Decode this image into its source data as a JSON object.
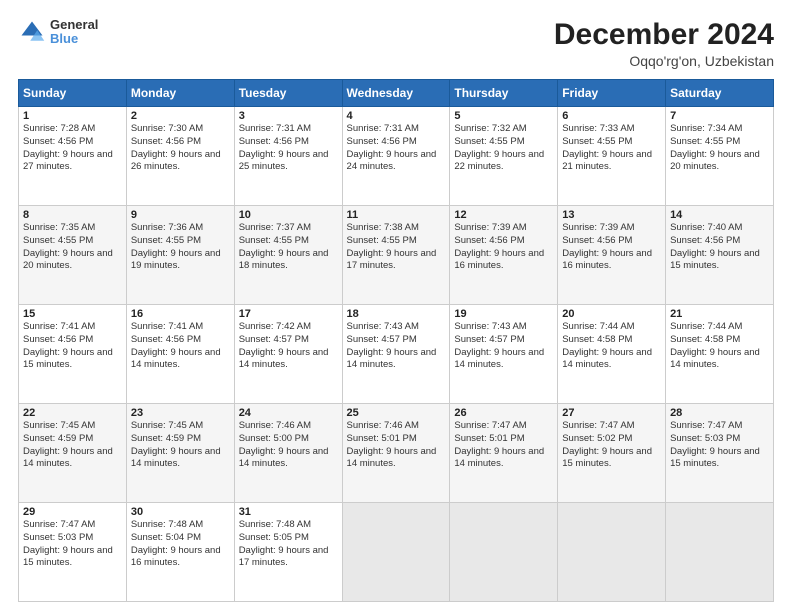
{
  "header": {
    "logo_line1": "General",
    "logo_line2": "Blue",
    "month": "December 2024",
    "location": "Oqqo'rg'on, Uzbekistan"
  },
  "days_of_week": [
    "Sunday",
    "Monday",
    "Tuesday",
    "Wednesday",
    "Thursday",
    "Friday",
    "Saturday"
  ],
  "weeks": [
    [
      {
        "day": 1,
        "sunrise": "7:28 AM",
        "sunset": "4:56 PM",
        "daylight": "9 hours and 27 minutes"
      },
      {
        "day": 2,
        "sunrise": "7:30 AM",
        "sunset": "4:56 PM",
        "daylight": "9 hours and 26 minutes"
      },
      {
        "day": 3,
        "sunrise": "7:31 AM",
        "sunset": "4:56 PM",
        "daylight": "9 hours and 25 minutes"
      },
      {
        "day": 4,
        "sunrise": "7:31 AM",
        "sunset": "4:56 PM",
        "daylight": "9 hours and 24 minutes"
      },
      {
        "day": 5,
        "sunrise": "7:32 AM",
        "sunset": "4:55 PM",
        "daylight": "9 hours and 22 minutes"
      },
      {
        "day": 6,
        "sunrise": "7:33 AM",
        "sunset": "4:55 PM",
        "daylight": "9 hours and 21 minutes"
      },
      {
        "day": 7,
        "sunrise": "7:34 AM",
        "sunset": "4:55 PM",
        "daylight": "9 hours and 20 minutes"
      }
    ],
    [
      {
        "day": 8,
        "sunrise": "7:35 AM",
        "sunset": "4:55 PM",
        "daylight": "9 hours and 20 minutes"
      },
      {
        "day": 9,
        "sunrise": "7:36 AM",
        "sunset": "4:55 PM",
        "daylight": "9 hours and 19 minutes"
      },
      {
        "day": 10,
        "sunrise": "7:37 AM",
        "sunset": "4:55 PM",
        "daylight": "9 hours and 18 minutes"
      },
      {
        "day": 11,
        "sunrise": "7:38 AM",
        "sunset": "4:55 PM",
        "daylight": "9 hours and 17 minutes"
      },
      {
        "day": 12,
        "sunrise": "7:39 AM",
        "sunset": "4:56 PM",
        "daylight": "9 hours and 16 minutes"
      },
      {
        "day": 13,
        "sunrise": "7:39 AM",
        "sunset": "4:56 PM",
        "daylight": "9 hours and 16 minutes"
      },
      {
        "day": 14,
        "sunrise": "7:40 AM",
        "sunset": "4:56 PM",
        "daylight": "9 hours and 15 minutes"
      }
    ],
    [
      {
        "day": 15,
        "sunrise": "7:41 AM",
        "sunset": "4:56 PM",
        "daylight": "9 hours and 15 minutes"
      },
      {
        "day": 16,
        "sunrise": "7:41 AM",
        "sunset": "4:56 PM",
        "daylight": "9 hours and 14 minutes"
      },
      {
        "day": 17,
        "sunrise": "7:42 AM",
        "sunset": "4:57 PM",
        "daylight": "9 hours and 14 minutes"
      },
      {
        "day": 18,
        "sunrise": "7:43 AM",
        "sunset": "4:57 PM",
        "daylight": "9 hours and 14 minutes"
      },
      {
        "day": 19,
        "sunrise": "7:43 AM",
        "sunset": "4:57 PM",
        "daylight": "9 hours and 14 minutes"
      },
      {
        "day": 20,
        "sunrise": "7:44 AM",
        "sunset": "4:58 PM",
        "daylight": "9 hours and 14 minutes"
      },
      {
        "day": 21,
        "sunrise": "7:44 AM",
        "sunset": "4:58 PM",
        "daylight": "9 hours and 14 minutes"
      }
    ],
    [
      {
        "day": 22,
        "sunrise": "7:45 AM",
        "sunset": "4:59 PM",
        "daylight": "9 hours and 14 minutes"
      },
      {
        "day": 23,
        "sunrise": "7:45 AM",
        "sunset": "4:59 PM",
        "daylight": "9 hours and 14 minutes"
      },
      {
        "day": 24,
        "sunrise": "7:46 AM",
        "sunset": "5:00 PM",
        "daylight": "9 hours and 14 minutes"
      },
      {
        "day": 25,
        "sunrise": "7:46 AM",
        "sunset": "5:01 PM",
        "daylight": "9 hours and 14 minutes"
      },
      {
        "day": 26,
        "sunrise": "7:47 AM",
        "sunset": "5:01 PM",
        "daylight": "9 hours and 14 minutes"
      },
      {
        "day": 27,
        "sunrise": "7:47 AM",
        "sunset": "5:02 PM",
        "daylight": "9 hours and 15 minutes"
      },
      {
        "day": 28,
        "sunrise": "7:47 AM",
        "sunset": "5:03 PM",
        "daylight": "9 hours and 15 minutes"
      }
    ],
    [
      {
        "day": 29,
        "sunrise": "7:47 AM",
        "sunset": "5:03 PM",
        "daylight": "9 hours and 15 minutes"
      },
      {
        "day": 30,
        "sunrise": "7:48 AM",
        "sunset": "5:04 PM",
        "daylight": "9 hours and 16 minutes"
      },
      {
        "day": 31,
        "sunrise": "7:48 AM",
        "sunset": "5:05 PM",
        "daylight": "9 hours and 17 minutes"
      },
      null,
      null,
      null,
      null
    ]
  ]
}
